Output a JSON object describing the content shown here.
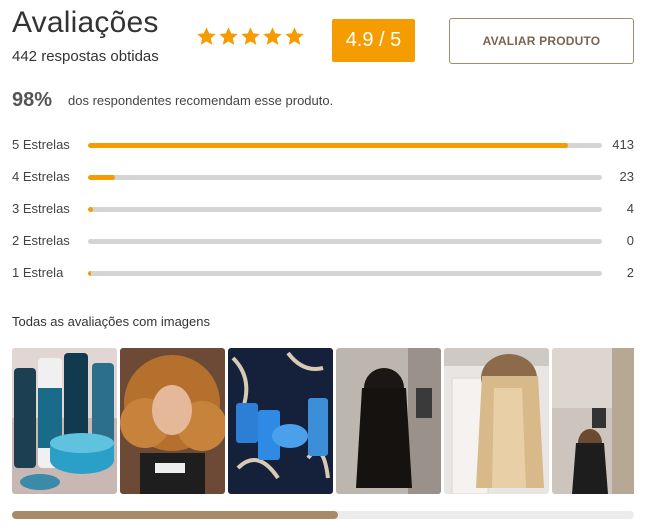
{
  "header": {
    "title": "Avaliações",
    "responses": "442 respostas obtidas",
    "stars_filled": 5,
    "score": "4.9 / 5",
    "rate_button": "AVALIAR PRODUTO"
  },
  "recommend": {
    "percent": "98%",
    "text": "dos respondentes recomendam esse produto."
  },
  "ratings": [
    {
      "label": "5 Estrelas",
      "count": "413",
      "fraction": 0.934
    },
    {
      "label": "4 Estrelas",
      "count": "23",
      "fraction": 0.052
    },
    {
      "label": "3 Estrelas",
      "count": "4",
      "fraction": 0.009
    },
    {
      "label": "2 Estrelas",
      "count": "0",
      "fraction": 0.0
    },
    {
      "label": "1 Estrela",
      "count": "2",
      "fraction": 0.005
    }
  ],
  "gallery": {
    "heading": "Todas as avaliações com imagens",
    "images": [
      {
        "name": "review-photo-products-bottles"
      },
      {
        "name": "review-photo-curly-hair"
      },
      {
        "name": "review-photo-products-on-fabric"
      },
      {
        "name": "review-photo-dark-straight-hair"
      },
      {
        "name": "review-photo-blonde-hair"
      },
      {
        "name": "review-photo-mirror-selfie"
      }
    ]
  },
  "colors": {
    "accent": "#f59c00",
    "brand_brown": "#a88a69",
    "track": "#d4d4d4"
  }
}
